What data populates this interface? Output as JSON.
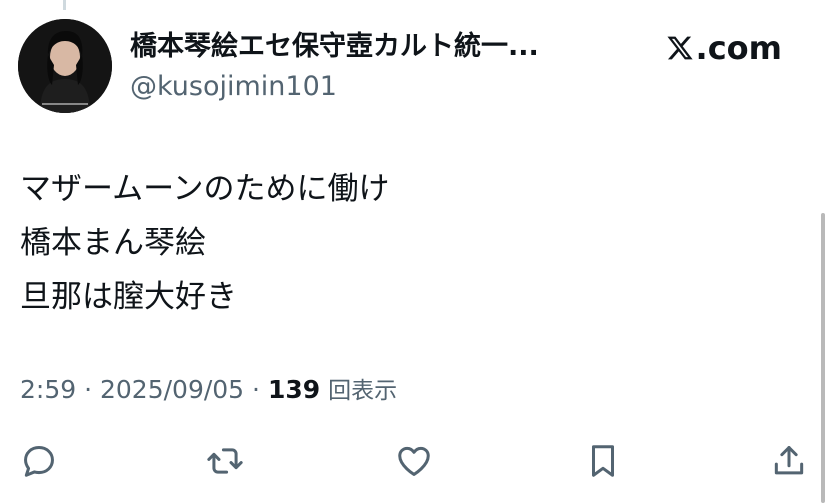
{
  "tweet": {
    "display_name": "橋本琴絵エセ保守壺カルト統一...",
    "handle": "@kusojimin101",
    "brand": ".com",
    "lines": [
      "マザームーンのために働け",
      "橋本まん琴絵",
      "旦那は膣大好き"
    ],
    "time": "2:59",
    "separator": "·",
    "date": "2025/09/05",
    "views_count": "139",
    "views_label": "回表示"
  },
  "icons": {
    "reply": "reply-icon",
    "retweet": "retweet-icon",
    "like": "heart-icon",
    "bookmark": "bookmark-icon",
    "share": "share-icon",
    "logo": "x-logo-icon"
  },
  "colors": {
    "text": "#0f1419",
    "secondary": "#536471",
    "background": "#ffffff"
  }
}
